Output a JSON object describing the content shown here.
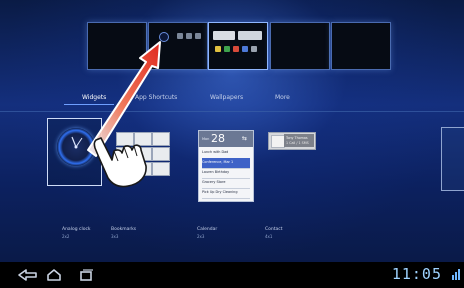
{
  "tabs": [
    {
      "label": "Widgets",
      "active": true
    },
    {
      "label": "App Shortcuts",
      "active": false
    },
    {
      "label": "Wallpapers",
      "active": false
    },
    {
      "label": "More",
      "active": false
    }
  ],
  "widgets": [
    {
      "name": "Analog clock",
      "size": "2x2"
    },
    {
      "name": "Bookmarks",
      "size": "3x3"
    },
    {
      "name": "Calendar",
      "size": "2x3"
    },
    {
      "name": "Contact",
      "size": "4x1"
    }
  ],
  "calendar": {
    "day": "28",
    "weekday": "Mon",
    "events": [
      "Lunch with Dad",
      "Conference, Mar 1",
      "Lauren Birthday",
      "Grocery Store",
      "Pick Up Dry Cleaning"
    ]
  },
  "contact": {
    "line1": "Tony Thomas",
    "line2": "1 Call / 1 SMS"
  },
  "status": {
    "time": "11:05"
  },
  "colors": {
    "accent": "#6f9fff",
    "arrow_red": "#e02a1e",
    "clock_cyan": "#9fd3ff"
  },
  "icons": [
    "back-icon",
    "home-icon",
    "recent-apps-icon",
    "signal-icon",
    "hand-pointer-icon"
  ]
}
